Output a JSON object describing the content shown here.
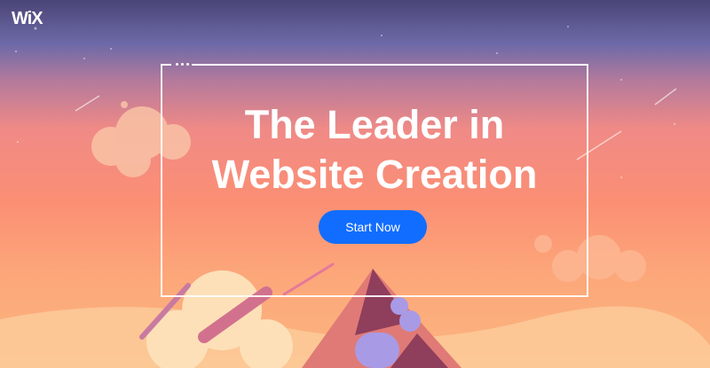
{
  "brand": {
    "logo": "WiX"
  },
  "hero": {
    "title_line1": "The Leader in",
    "title_line2": "Website Creation",
    "cta_label": "Start Now"
  },
  "colors": {
    "cta": "#116dff",
    "sky_top": "#4a4577",
    "sky_bottom": "#fbb57f"
  }
}
